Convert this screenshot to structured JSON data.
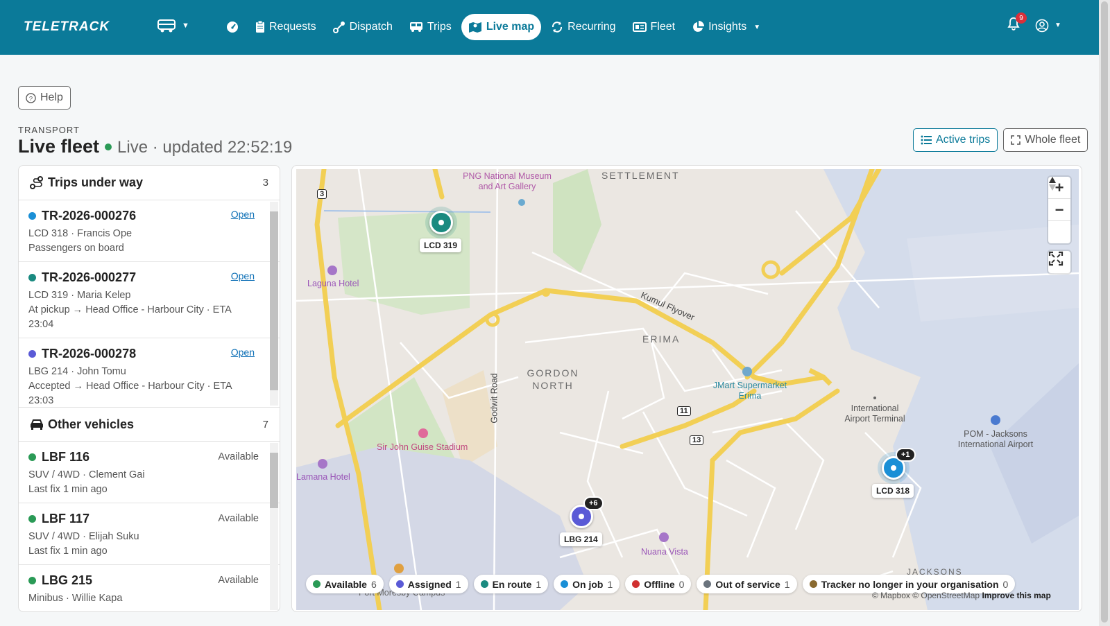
{
  "nav": {
    "brand": "TELETRACK",
    "items": [
      {
        "label": "",
        "icon": "gauge-icon"
      },
      {
        "label": "Requests",
        "icon": "clipboard-icon"
      },
      {
        "label": "Dispatch",
        "icon": "route-icon"
      },
      {
        "label": "Trips",
        "icon": "bus-icon"
      },
      {
        "label": "Live map",
        "icon": "map-icon"
      },
      {
        "label": "Recurring",
        "icon": "repeat-icon"
      },
      {
        "label": "Fleet",
        "icon": "idcard-icon"
      },
      {
        "label": "Insights",
        "icon": "pie-chart-icon"
      }
    ],
    "active_label": "Live map",
    "notification_count": "9"
  },
  "header": {
    "help_label": "Help",
    "section": "TRANSPORT",
    "title": "Live fleet",
    "live_status": "Live · updated 22:52:19",
    "active_trips_label": "Active trips",
    "whole_fleet_label": "Whole fleet"
  },
  "trips": {
    "title": "Trips under way",
    "count": "3",
    "items": [
      {
        "id": "TR-2026-000276",
        "color": "#1a8fd6",
        "line1": "LCD 318 · Francis Ope",
        "line2": "Passengers on board",
        "open": "Open"
      },
      {
        "id": "TR-2026-000277",
        "color": "#1a8a80",
        "line1": "LCD 319 · Maria Kelep",
        "line2": "At pickup → Head Office - Harbour City · ETA 23:04",
        "open": "Open"
      },
      {
        "id": "TR-2026-000278",
        "color": "#5a5ad6",
        "line1": "LBG 214 · John Tomu",
        "line2": "Accepted → Head Office - Harbour City · ETA 23:03",
        "open": "Open"
      }
    ]
  },
  "vehicles": {
    "title": "Other vehicles",
    "count": "7",
    "items": [
      {
        "id": "LBF 116",
        "color": "#2a9a56",
        "status": "Available",
        "line1": "SUV / 4WD · Clement Gai",
        "line2": "Last fix 1 min ago"
      },
      {
        "id": "LBF 117",
        "color": "#2a9a56",
        "status": "Available",
        "line1": "SUV / 4WD · Elijah Suku",
        "line2": "Last fix 1 min ago"
      },
      {
        "id": "LBG 215",
        "color": "#2a9a56",
        "status": "Available",
        "line1": "Minibus · Willie Kapa",
        "line2": ""
      }
    ]
  },
  "map": {
    "labels": {
      "museum": "PNG National Museum and Art Gallery",
      "settlement": "SETTLEMENT",
      "laguna": "Laguna Hotel",
      "kumul": "Kumul Flyover",
      "erima": "ERIMA",
      "gordon": "GORDON NORTH",
      "godwit": "Godwit Road",
      "jmart": "JMart Supermarket Erima",
      "intl": "International Airport Terminal",
      "pom": "POM - Jacksons International Airport",
      "stadium": "Sir John Guise Stadium",
      "lamana": "Lamana Hotel",
      "nuana": "Nuana Vista",
      "jacksons": "JACKSONS",
      "campus": "Port Moresby Campus",
      "r3": "3",
      "r11": "11",
      "r13": "13"
    },
    "markers": {
      "lcd319": {
        "label": "LCD 319",
        "color": "#1a8a80"
      },
      "lcd318": {
        "label": "LCD 318",
        "color": "#1a8fd6",
        "extra": "+1"
      },
      "lbg214": {
        "label": "LBG 214",
        "color": "#5a5ad6",
        "extra": "+6"
      }
    },
    "zoom_in": "+",
    "zoom_out": "−",
    "attribution": "© Mapbox © OpenStreetMap",
    "improve": "Improve this map"
  },
  "legend": [
    {
      "label": "Available",
      "count": "6",
      "color": "#2a9a56"
    },
    {
      "label": "Assigned",
      "count": "1",
      "color": "#5a5ad6"
    },
    {
      "label": "En route",
      "count": "1",
      "color": "#1a8a80"
    },
    {
      "label": "On job",
      "count": "1",
      "color": "#1a8fd6"
    },
    {
      "label": "Offline",
      "count": "0",
      "color": "#d03030"
    },
    {
      "label": "Out of service",
      "count": "1",
      "color": "#6a737d"
    },
    {
      "label": "Tracker no longer in your organisation",
      "count": "0",
      "color": "#8a6a30"
    }
  ]
}
